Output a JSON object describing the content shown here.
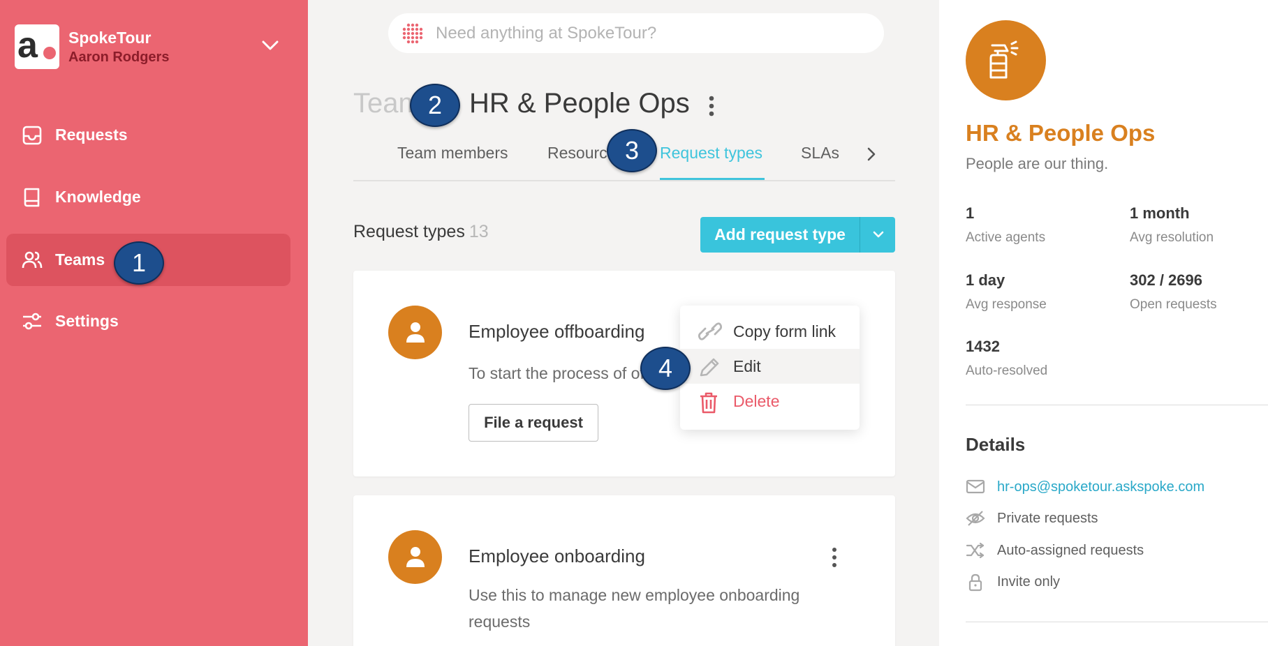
{
  "sidebar": {
    "org_name": "SpokeTour",
    "user_name": "Aaron Rodgers",
    "logo_letter": "a",
    "items": [
      {
        "label": "Requests",
        "icon": "inbox-icon"
      },
      {
        "label": "Knowledge",
        "icon": "book-icon"
      },
      {
        "label": "Teams",
        "icon": "people-icon",
        "active": true
      },
      {
        "label": "Settings",
        "icon": "sliders-icon"
      }
    ]
  },
  "search": {
    "placeholder": "Need anything at SpokeTour?"
  },
  "header": {
    "breadcrumb": "Team",
    "title": "HR & People Ops",
    "tabs": [
      "Team members",
      "Resources",
      "Request types",
      "SLAs"
    ],
    "active_tab": "Request types"
  },
  "request_types": {
    "heading": "Request types",
    "count": "13",
    "add_button": "Add request type",
    "cards": [
      {
        "name": "Employee offboarding",
        "desc": "To start the process of offboarding",
        "button": "File a request"
      },
      {
        "name": "Employee onboarding",
        "desc": "Use this to manage new employee onboarding requests"
      }
    ]
  },
  "context_menu": {
    "items": [
      {
        "label": "Copy form link",
        "icon": "link-icon"
      },
      {
        "label": "Edit",
        "icon": "pencil-icon"
      },
      {
        "label": "Delete",
        "icon": "trash-icon"
      }
    ]
  },
  "callouts": [
    "1",
    "2",
    "3",
    "4"
  ],
  "team_panel": {
    "name": "HR & People Ops",
    "tagline": "People are our thing.",
    "stats": [
      {
        "value": "1",
        "label": "Active agents"
      },
      {
        "value": "1 month",
        "label": "Avg resolution"
      },
      {
        "value": "1 day",
        "label": "Avg response"
      },
      {
        "value": "302 / 2696",
        "label": "Open requests"
      },
      {
        "value": "1432",
        "label": "Auto-resolved"
      }
    ],
    "details_heading": "Details",
    "details": [
      {
        "text": "hr-ops@spoketour.askspoke.com",
        "icon": "mail-icon"
      },
      {
        "text": "Private requests",
        "icon": "eye-off-icon"
      },
      {
        "text": "Auto-assigned requests",
        "icon": "shuffle-icon"
      },
      {
        "text": "Invite only",
        "icon": "lock-icon"
      }
    ]
  },
  "colors": {
    "sidebar": "#eb6571",
    "sidebar_active": "#dd535f",
    "accent": "#39c4dc",
    "team_orange": "#d9801f",
    "danger": "#ea5a69",
    "callout": "#1d4e8d"
  }
}
